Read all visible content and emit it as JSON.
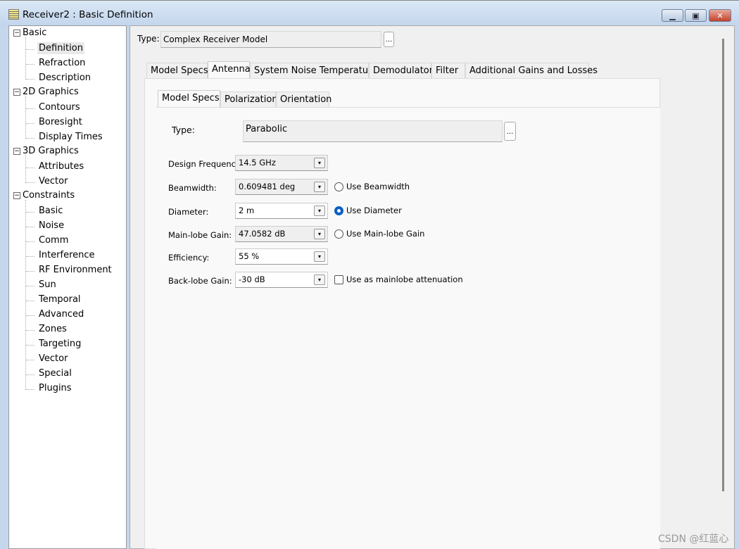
{
  "window": {
    "title": "Receiver2 : Basic Definition",
    "buttons": [
      "minimize",
      "maximize",
      "close"
    ]
  },
  "tree": [
    {
      "label": "Basic",
      "children": [
        "Definition",
        "Refraction",
        "Description"
      ]
    },
    {
      "label": "2D Graphics",
      "children": [
        "Contours",
        "Boresight",
        "Display Times"
      ]
    },
    {
      "label": "3D Graphics",
      "children": [
        "Attributes",
        "Vector"
      ]
    },
    {
      "label": "Constraints",
      "children": [
        "Basic",
        "Noise",
        "Comm",
        "Interference",
        "RF Environment",
        "Sun",
        "Temporal",
        "Advanced",
        "Zones",
        "Targeting",
        "Vector",
        "Special",
        "Plugins"
      ]
    }
  ],
  "tree_selected": "Definition",
  "type": {
    "label": "Type:",
    "value": "Complex Receiver Model",
    "button": "..."
  },
  "tabs": [
    "Model Specs",
    "Antenna",
    "System Noise Temperature",
    "Demodulator",
    "Filter",
    "Additional Gains and Losses"
  ],
  "active_tab": "Antenna",
  "subtabs": [
    "Model Specs",
    "Polarization",
    "Orientation"
  ],
  "active_subtab": "Model Specs",
  "antenna": {
    "type_label": "Type:",
    "type_value": "Parabolic",
    "type_button": "...",
    "fields": [
      {
        "label": "Design Frequency:",
        "value": "14.5 GHz",
        "readonly": true
      },
      {
        "label": "Beamwidth:",
        "value": "0.609481 deg",
        "readonly": true,
        "option": "Use Beamwidth",
        "option_type": "radio",
        "checked": false
      },
      {
        "label": "Diameter:",
        "value": "2 m",
        "readonly": false,
        "option": "Use Diameter",
        "option_type": "radio",
        "checked": true
      },
      {
        "label": "Main-lobe Gain:",
        "value": "47.0582 dB",
        "readonly": true,
        "option": "Use Main-lobe Gain",
        "option_type": "radio",
        "checked": false
      },
      {
        "label": "Efficiency:",
        "value": "55 %",
        "readonly": false
      },
      {
        "label": "Back-lobe Gain:",
        "value": "-30 dB",
        "readonly": false,
        "option": "Use as mainlobe attenuation",
        "option_type": "checkbox",
        "checked": false
      }
    ]
  },
  "accent": "#0a5fc4",
  "watermark": "CSDN @红蓝心"
}
